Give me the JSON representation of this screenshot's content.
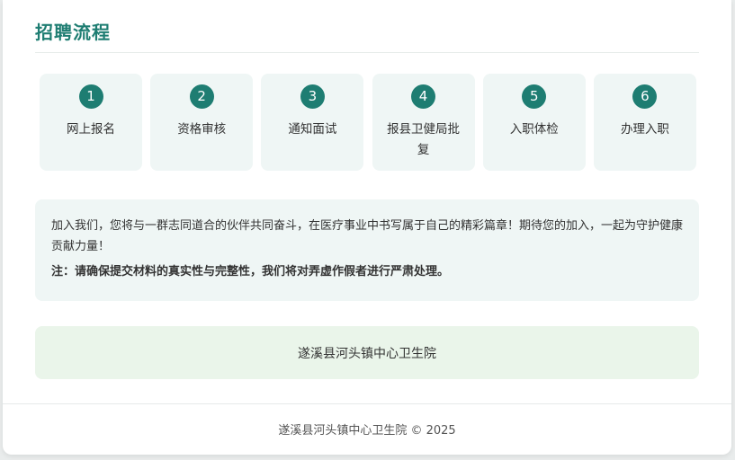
{
  "section": {
    "title": "招聘流程"
  },
  "steps": [
    {
      "number": "1",
      "label": "网上报名"
    },
    {
      "number": "2",
      "label": "资格审核"
    },
    {
      "number": "3",
      "label": "通知面试"
    },
    {
      "number": "4",
      "label": "报县卫健局批复"
    },
    {
      "number": "5",
      "label": "入职体检"
    },
    {
      "number": "6",
      "label": "办理入职"
    }
  ],
  "info": {
    "text": "加入我们，您将与一群志同道合的伙伴共同奋斗，在医疗事业中书写属于自己的精彩篇章！期待您的加入，一起为守护健康贡献力量！",
    "note": "注：请确保提交材料的真实性与完整性，我们将对弄虚作假者进行严肃处理。"
  },
  "organization": {
    "name": "遂溪县河头镇中心卫生院"
  },
  "footer": {
    "text": "遂溪县河头镇中心卫生院 © 2025"
  },
  "colors": {
    "accent": "#1e7d72",
    "step_bg": "#eff6f5",
    "org_bg": "#eaf5ea"
  }
}
